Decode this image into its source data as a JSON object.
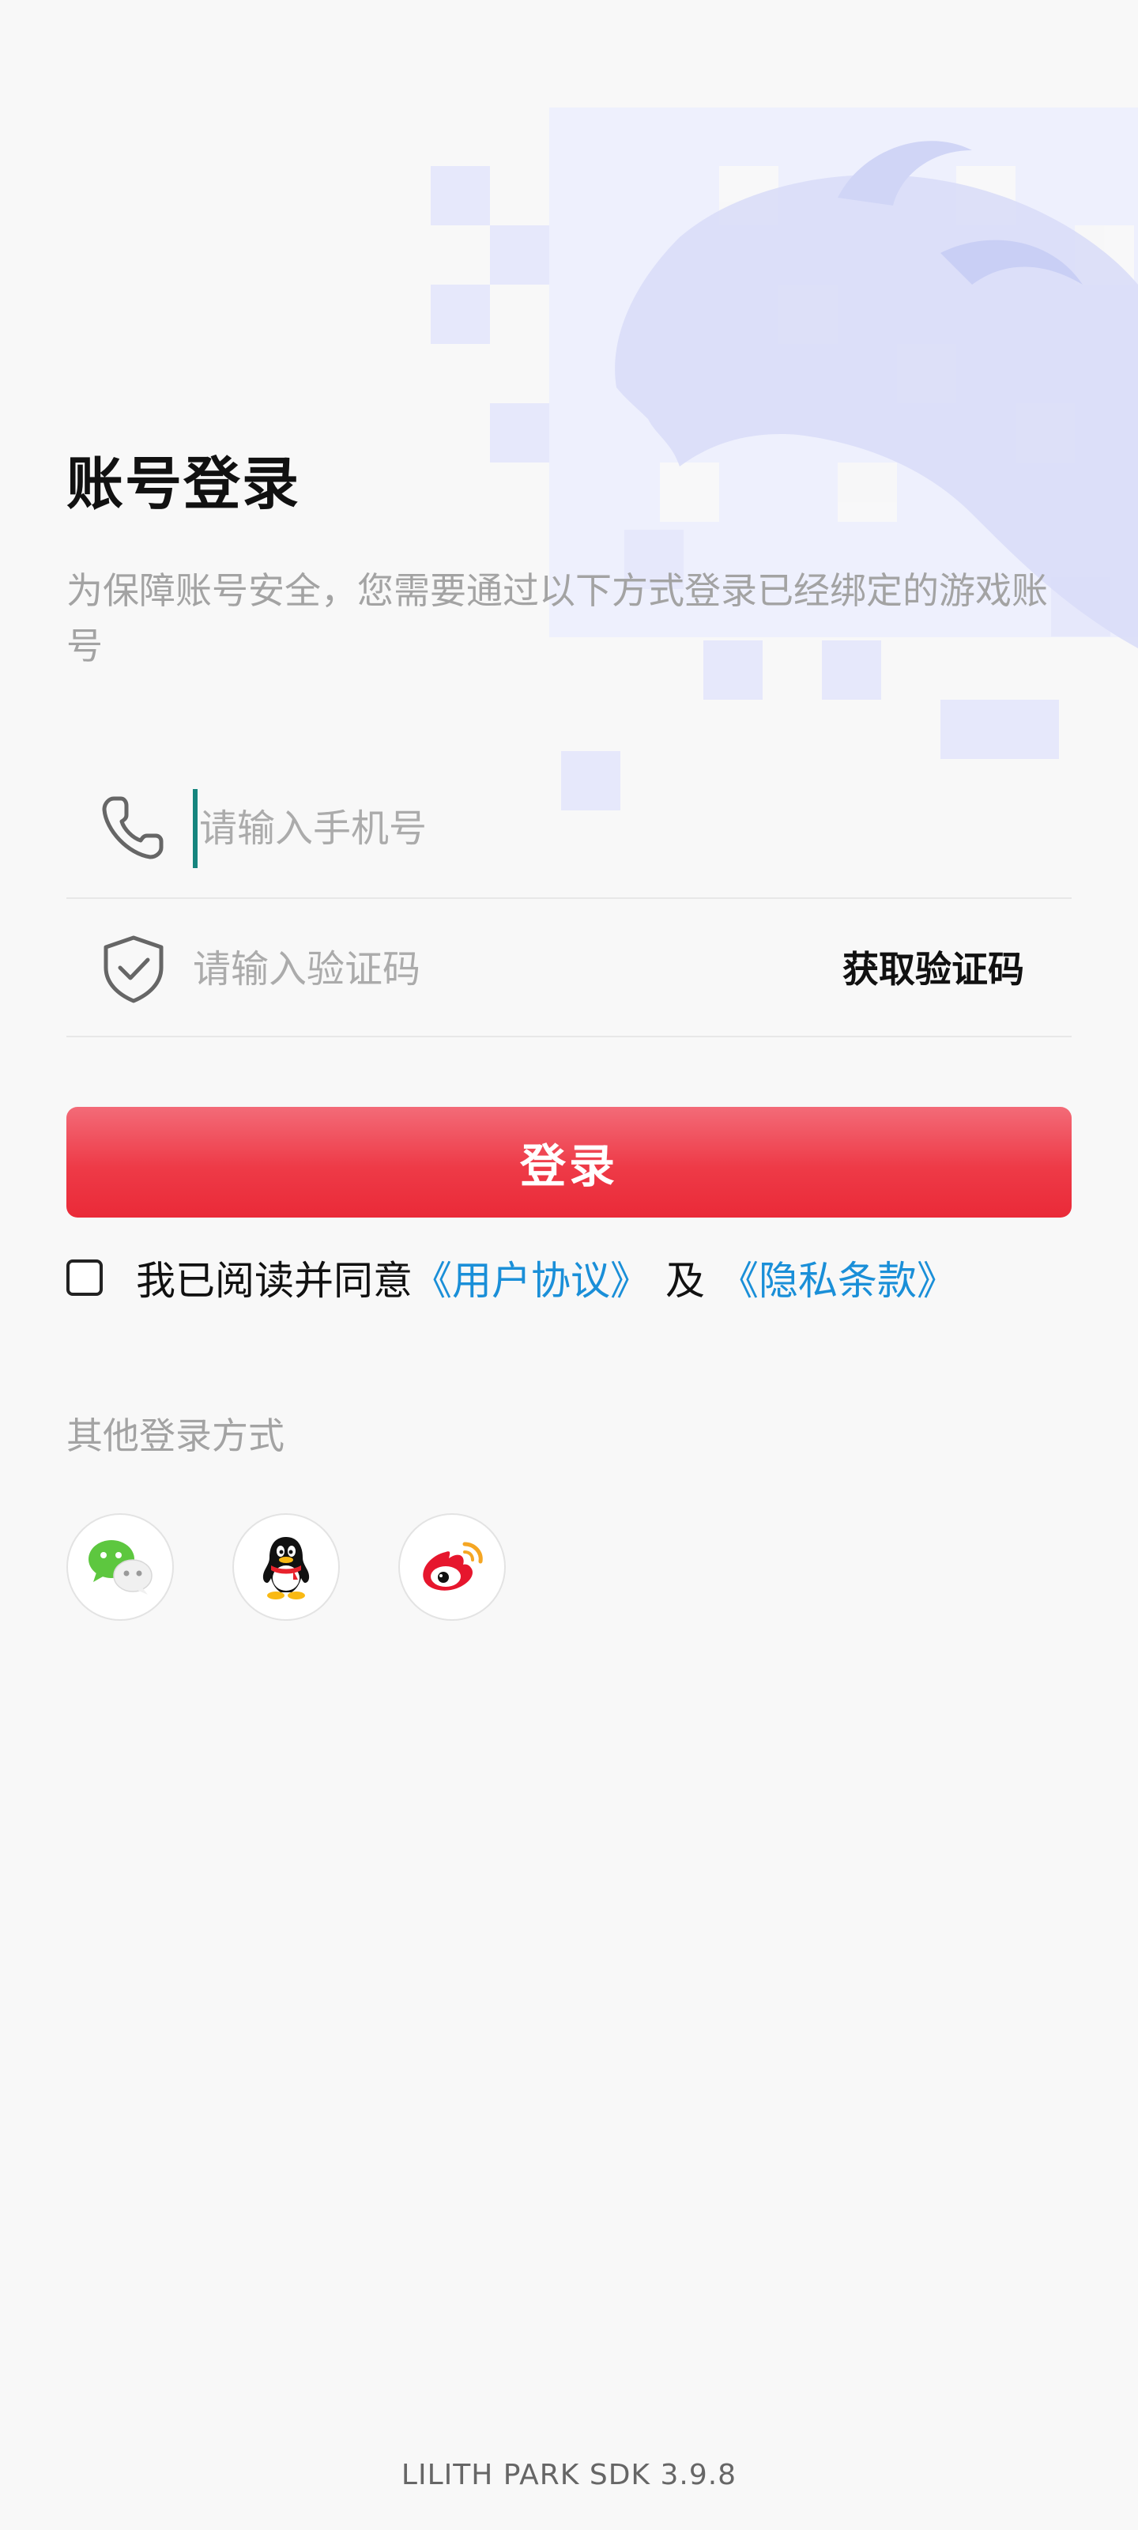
{
  "page": {
    "title": "账号登录",
    "subtitle": "为保障账号安全，您需要通过以下方式登录已经绑定的游戏账号"
  },
  "form": {
    "phone_placeholder": "请输入手机号",
    "code_placeholder": "请输入验证码",
    "get_code_label": "获取验证码",
    "login_label": "登录"
  },
  "agreement": {
    "prefix": "我已阅读并同意",
    "user_agreement": "《用户协议》",
    "and": "及",
    "privacy": "《隐私条款》",
    "checked": false
  },
  "other_login": {
    "title": "其他登录方式",
    "options": [
      {
        "name": "wechat",
        "icon": "wechat-icon"
      },
      {
        "name": "qq",
        "icon": "qq-icon"
      },
      {
        "name": "weibo",
        "icon": "weibo-icon"
      }
    ]
  },
  "footer": {
    "version": "LILITH PARK SDK 3.9.8"
  },
  "colors": {
    "background": "#f8f8f8",
    "accent_red": "#ee3a47",
    "link_blue": "#1a8fd8",
    "cursor_teal": "#16857e",
    "placeholder_gray": "#ababab"
  }
}
